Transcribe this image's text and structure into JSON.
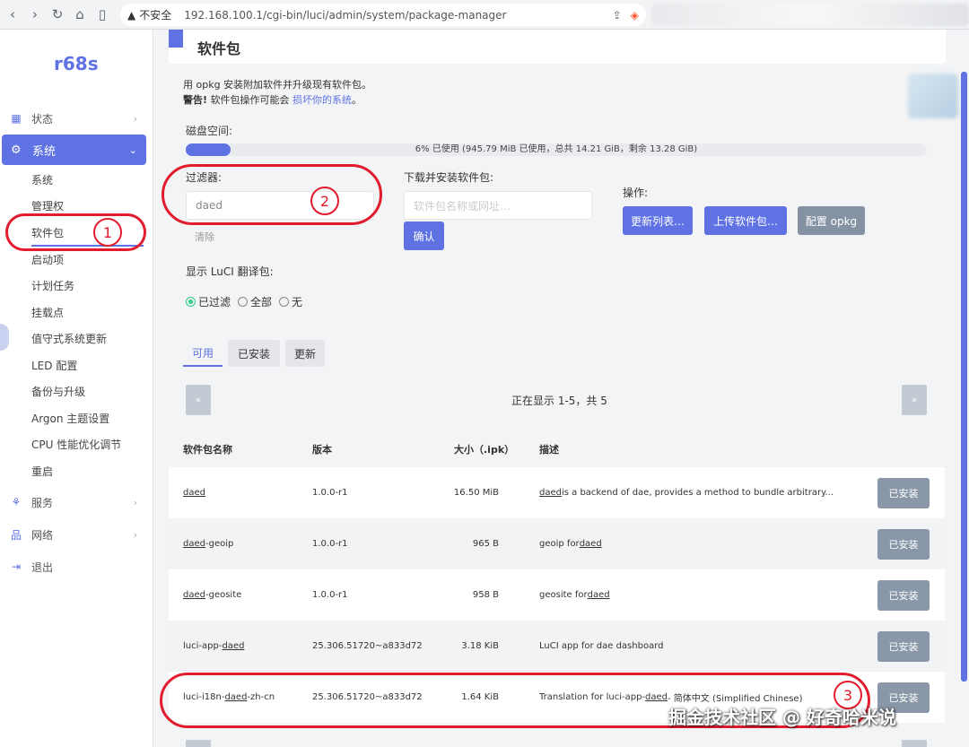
{
  "browser": {
    "warning": "▲",
    "insecure_label": "不安全",
    "url": "192.168.100.1/cgi-bin/luci/admin/system/package-manager"
  },
  "sidebar": {
    "logo": "r68s",
    "status": "状态",
    "system": "系统",
    "sub_items": [
      "系统",
      "管理权",
      "软件包",
      "启动项",
      "计划任务",
      "挂载点",
      "值守式系统更新",
      "LED 配置",
      "备份与升级",
      "Argon 主题设置",
      "CPU 性能优化调节",
      "重启"
    ],
    "services": "服务",
    "network": "网络",
    "logout": "退出"
  },
  "page": {
    "title": "软件包",
    "desc1": "用 opkg 安装附加软件并升级现有软件包。",
    "desc2_bold": "警告!",
    "desc2_text": " 软件包操作可能会 ",
    "desc2_link": "损坏你的系统",
    "desc2_end": "。",
    "disk_label": "磁盘空间:",
    "disk_used_fraction": 0.06,
    "disk_text": "6% 已使用 (945.79 MiB 已使用，总共 14.21 GiB，剩余 13.28 GiB)",
    "filter_label": "过滤器:",
    "filter_value": "daed",
    "clear_label": "清除",
    "download_label": "下载并安装软件包:",
    "download_placeholder": "软件包名称或网址…",
    "confirm_label": "确认",
    "actions_label": "操作:",
    "update_lists": "更新列表…",
    "upload_package": "上传软件包…",
    "configure_opkg": "配置 opkg",
    "luci_label": "显示 LuCI 翻译包:",
    "radio_filtered": "已过滤",
    "radio_all": "全部",
    "radio_none": "无",
    "tab_available": "可用",
    "tab_installed": "已安装",
    "tab_updates": "更新",
    "pager_prev": "«",
    "pager_next": "»",
    "pager_text": "正在显示 1-5，共 5"
  },
  "table": {
    "headers": [
      "软件包名称",
      "版本",
      "大小（.ipk）",
      "描述"
    ],
    "installed_label": "已安装",
    "rows": [
      {
        "name_pre": "",
        "name_link": "daed",
        "name_post": "",
        "version": "1.0.0-r1",
        "size": "16.50 MiB",
        "desc_pre": "",
        "desc_link": "daed",
        "desc_post": " is a backend of dae, provides a method to bundle arbitrary..."
      },
      {
        "name_pre": "",
        "name_link": "daed",
        "name_post": "-geoip",
        "version": "1.0.0-r1",
        "size": "965 B",
        "desc_pre": "geoip for ",
        "desc_link": "daed",
        "desc_post": ""
      },
      {
        "name_pre": "",
        "name_link": "daed",
        "name_post": "-geosite",
        "version": "1.0.0-r1",
        "size": "958 B",
        "desc_pre": "geosite for ",
        "desc_link": "daed",
        "desc_post": ""
      },
      {
        "name_pre": "luci-app-",
        "name_link": "daed",
        "name_post": "",
        "version": "25.306.51720~a833d72",
        "size": "3.18 KiB",
        "desc_pre": "LuCI app for dae dashboard",
        "desc_link": "",
        "desc_post": ""
      },
      {
        "name_pre": "luci-i18n-",
        "name_link": "daed",
        "name_post": "-zh-cn",
        "version": "25.306.51720~a833d72",
        "size": "1.64 KiB",
        "desc_pre": "Translation for luci-app-",
        "desc_link": "daed",
        "desc_post": " - 简体中文 (Simplified Chinese)"
      }
    ]
  },
  "annotations": {
    "one": "1",
    "two": "2",
    "three": "3"
  },
  "watermark": "掘金技术社区 @ 好奇哈米说",
  "colors": {
    "accent": "#5e72e4",
    "annotation": "#e21b2d",
    "installed_button": "#8a97a8"
  }
}
